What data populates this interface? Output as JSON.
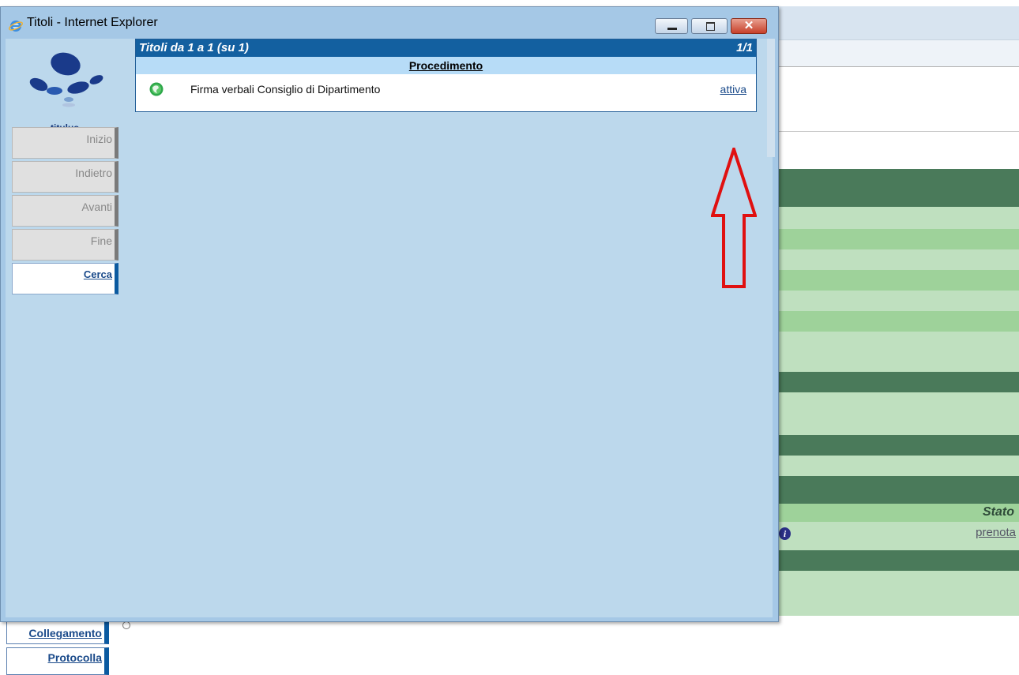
{
  "window": {
    "title": "Titoli - Internet Explorer",
    "controls": {
      "minimize": "",
      "maximize": "",
      "close": "✕"
    }
  },
  "sidebar": {
    "logo_text": "titulus",
    "nav": [
      {
        "label": "Inizio",
        "active": false
      },
      {
        "label": "Indietro",
        "active": false
      },
      {
        "label": "Avanti",
        "active": false
      },
      {
        "label": "Fine",
        "active": false
      },
      {
        "label": "Cerca",
        "active": true
      }
    ]
  },
  "results": {
    "header": "Titoli da 1 a 1  (su 1)",
    "pager": "1/1",
    "column": "Procedimento",
    "rows": [
      {
        "icon": "green-globe-icon",
        "text": "Firma verbali Consiglio di Dipartimento",
        "action": "attiva"
      }
    ]
  },
  "annotation": {
    "shape": "red-up-arrow",
    "color": "#e01010"
  },
  "background_app": {
    "stato_label": "Stato",
    "prenota_link": "prenota",
    "info_icon": "i",
    "left_buttons": [
      "Collegamento",
      "Protocolla"
    ],
    "band_colors": {
      "dark": "#4a7a5a",
      "light": "#bfe0bf",
      "mid": "#9ed29a"
    }
  }
}
